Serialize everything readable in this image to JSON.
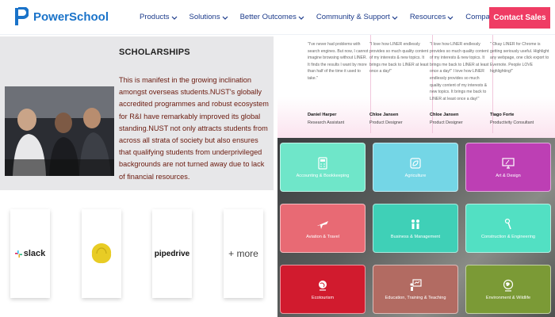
{
  "header": {
    "brand": "PowerSchool",
    "nav": [
      {
        "label": "Products"
      },
      {
        "label": "Solutions"
      },
      {
        "label": "Better Outcomes"
      },
      {
        "label": "Community & Support"
      },
      {
        "label": "Resources"
      },
      {
        "label": "Company"
      }
    ],
    "cta": "Contact Sales",
    "colors": {
      "brand": "#1a73c9",
      "nav": "#1b3a8a",
      "cta": "#ef3c64"
    }
  },
  "scholarships": {
    "title": "SCHOLARSHIPS",
    "body": "This is manifest in the growing inclination amongst overseas students.NUST's globally accredited programmes and robust ecosystem for R&I have remarkably improved its global standing.NUST not only attracts students from across all strata of society but also ensures that qualifying students from underprivileged backgrounds are not turned away due to lack of financial resources."
  },
  "partners": [
    {
      "name": "slack",
      "icon": "slack-logo"
    },
    {
      "name": "",
      "icon": "yellow-blob-logo"
    },
    {
      "name": "pipedrive",
      "icon": "pipedrive-logo"
    },
    {
      "name": "+ more",
      "icon": "more"
    }
  ],
  "testimonials": [
    {
      "quote": "\"I've never had problems with search engines. But now, I cannot imagine browsing without LINER. It finds the results I want by more than half of the time it used to take.\"",
      "name": "Daniel Harper",
      "role": "Research Assistant"
    },
    {
      "quote": "\"I love how LINER endlessly provides so much quality content of my interests & new topics. It brings me back to LINER at least once a day!\"",
      "name": "Chloe Jansen",
      "role": "Product Designer"
    },
    {
      "quote": "\"I love how LINER endlessly provides so much quality content of my interests & new topics. It brings me back to LINER at least once a day!\" I love how LINER endlessly provides so much quality content of my interests & new topics. It brings me back to LINER at least once a day!\"",
      "name": "Chloe Jansen",
      "role": "Product Designer"
    },
    {
      "quote": "\" Okay LINER for Chrome is getting seriously useful. Highlight any webpage, one click export to Evernote. People LOVE highlighting!\"",
      "name": "Tiago Forte",
      "role": "Productivity Consultant"
    }
  ],
  "careers": [
    {
      "label": "Accounting & Bookkeeping",
      "color": "#6fe6c9",
      "icon": "calculator-icon"
    },
    {
      "label": "Agriculture",
      "color": "#74d6e6",
      "icon": "leaf-icon"
    },
    {
      "label": "Art & Design",
      "color": "#bd3fb4",
      "icon": "monitor-icon"
    },
    {
      "label": "Aviation & Travel",
      "color": "#e86a74",
      "icon": "airplane-icon"
    },
    {
      "label": "Business & Management",
      "color": "#3fd0b7",
      "icon": "people-icon"
    },
    {
      "label": "Construction & Engineering",
      "color": "#52e0c3",
      "icon": "crane-icon"
    },
    {
      "label": "Ecotourism",
      "color": "#d11b2e",
      "icon": "globe-icon"
    },
    {
      "label": "Education, Training & Teaching",
      "color": "#b26b62",
      "icon": "presentation-icon"
    },
    {
      "label": "Environment & Wildlife",
      "color": "#7b9a36",
      "icon": "globe-leaf-icon"
    }
  ]
}
